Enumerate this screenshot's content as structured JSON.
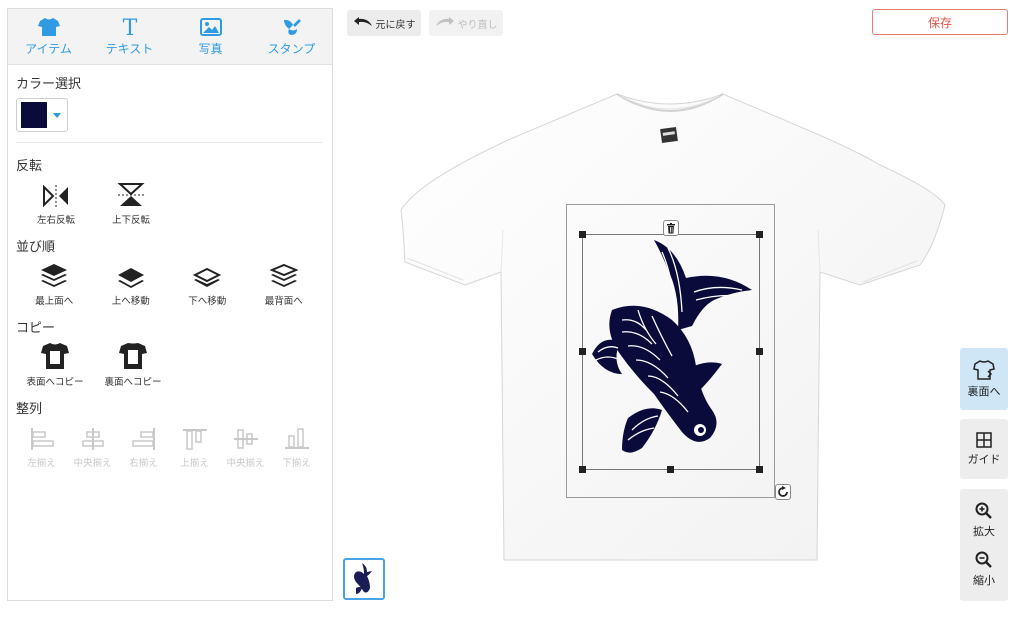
{
  "top_tabs": [
    {
      "label": "アイテム",
      "icon": "tshirt-icon"
    },
    {
      "label": "テキスト",
      "icon": "text-icon"
    },
    {
      "label": "写真",
      "icon": "photo-icon"
    },
    {
      "label": "スタンプ",
      "icon": "stamp-icon"
    }
  ],
  "color_section": {
    "title": "カラー選択",
    "selected_color": "#0b0b3b"
  },
  "flip_section": {
    "title": "反転",
    "items": [
      {
        "label": "左右反転",
        "icon": "flip-horizontal-icon"
      },
      {
        "label": "上下反転",
        "icon": "flip-vertical-icon"
      }
    ]
  },
  "order_section": {
    "title": "並び順",
    "items": [
      {
        "label": "最上面へ",
        "icon": "bring-to-front-icon"
      },
      {
        "label": "上へ移動",
        "icon": "bring-forward-icon"
      },
      {
        "label": "下へ移動",
        "icon": "send-backward-icon"
      },
      {
        "label": "最背面へ",
        "icon": "send-to-back-icon"
      }
    ]
  },
  "copy_section": {
    "title": "コピー",
    "items": [
      {
        "label": "表面へコピー",
        "icon": "copy-to-front-icon"
      },
      {
        "label": "裏面へコピー",
        "icon": "copy-to-back-icon"
      }
    ]
  },
  "align_section": {
    "title": "整列",
    "items": [
      {
        "label": "左揃え",
        "icon": "align-left-icon"
      },
      {
        "label": "中央揃え",
        "icon": "align-center-horizontal-icon"
      },
      {
        "label": "右揃え",
        "icon": "align-right-icon"
      },
      {
        "label": "上揃え",
        "icon": "align-top-icon"
      },
      {
        "label": "中央揃え",
        "icon": "align-middle-vertical-icon"
      },
      {
        "label": "下揃え",
        "icon": "align-bottom-icon"
      }
    ]
  },
  "toolbar": {
    "undo_label": "元に戻す",
    "redo_label": "やり直し",
    "save_label": "保存"
  },
  "right_tools": {
    "back_label": "裏面へ",
    "guide_label": "ガイド",
    "zoom_in_label": "拡大",
    "zoom_out_label": "縮小"
  },
  "colors": {
    "accent": "#2f9be2",
    "save_border": "#e57d72",
    "design_navy": "#0b0b3b"
  }
}
